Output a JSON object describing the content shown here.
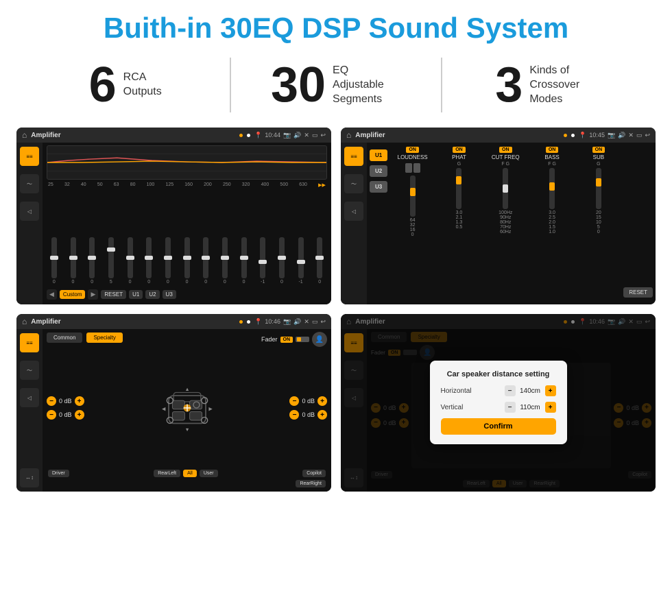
{
  "header": {
    "title": "Buith-in 30EQ DSP Sound System"
  },
  "stats": [
    {
      "number": "6",
      "label": "RCA\nOutputs"
    },
    {
      "number": "30",
      "label": "EQ Adjustable\nSegments"
    },
    {
      "number": "3",
      "label": "Kinds of\nCrossover Modes"
    }
  ],
  "screens": [
    {
      "id": "eq-screen",
      "status_time": "10:44",
      "app_title": "Amplifier",
      "eq_freqs": [
        "25",
        "32",
        "40",
        "50",
        "63",
        "80",
        "100",
        "125",
        "160",
        "200",
        "250",
        "320",
        "400",
        "500",
        "630"
      ],
      "eq_values": [
        "0",
        "0",
        "0",
        "5",
        "0",
        "0",
        "0",
        "0",
        "0",
        "0",
        "0",
        "-1",
        "0",
        "-1"
      ],
      "buttons": [
        "Custom",
        "RESET",
        "U1",
        "U2",
        "U3"
      ]
    },
    {
      "id": "crossover-screen",
      "status_time": "10:45",
      "app_title": "Amplifier",
      "presets": [
        "U1",
        "U2",
        "U3"
      ],
      "channels": [
        "LOUDNESS",
        "PHAT",
        "CUT FREQ",
        "BASS",
        "SUB"
      ]
    },
    {
      "id": "fader-screen",
      "status_time": "10:46",
      "app_title": "Amplifier",
      "tabs": [
        "Common",
        "Specialty"
      ],
      "fader_label": "Fader",
      "fader_on": "ON",
      "db_values": [
        "0 dB",
        "0 dB",
        "0 dB",
        "0 dB"
      ],
      "speaker_labels": [
        "Driver",
        "Copilot",
        "RearLeft",
        "All",
        "User",
        "RearRight"
      ]
    },
    {
      "id": "dialog-screen",
      "status_time": "10:46",
      "app_title": "Amplifier",
      "tabs": [
        "Common",
        "Specialty"
      ],
      "dialog": {
        "title": "Car speaker distance setting",
        "fields": [
          {
            "label": "Horizontal",
            "value": "140cm"
          },
          {
            "label": "Vertical",
            "value": "110cm"
          }
        ],
        "confirm_label": "Confirm"
      }
    }
  ]
}
